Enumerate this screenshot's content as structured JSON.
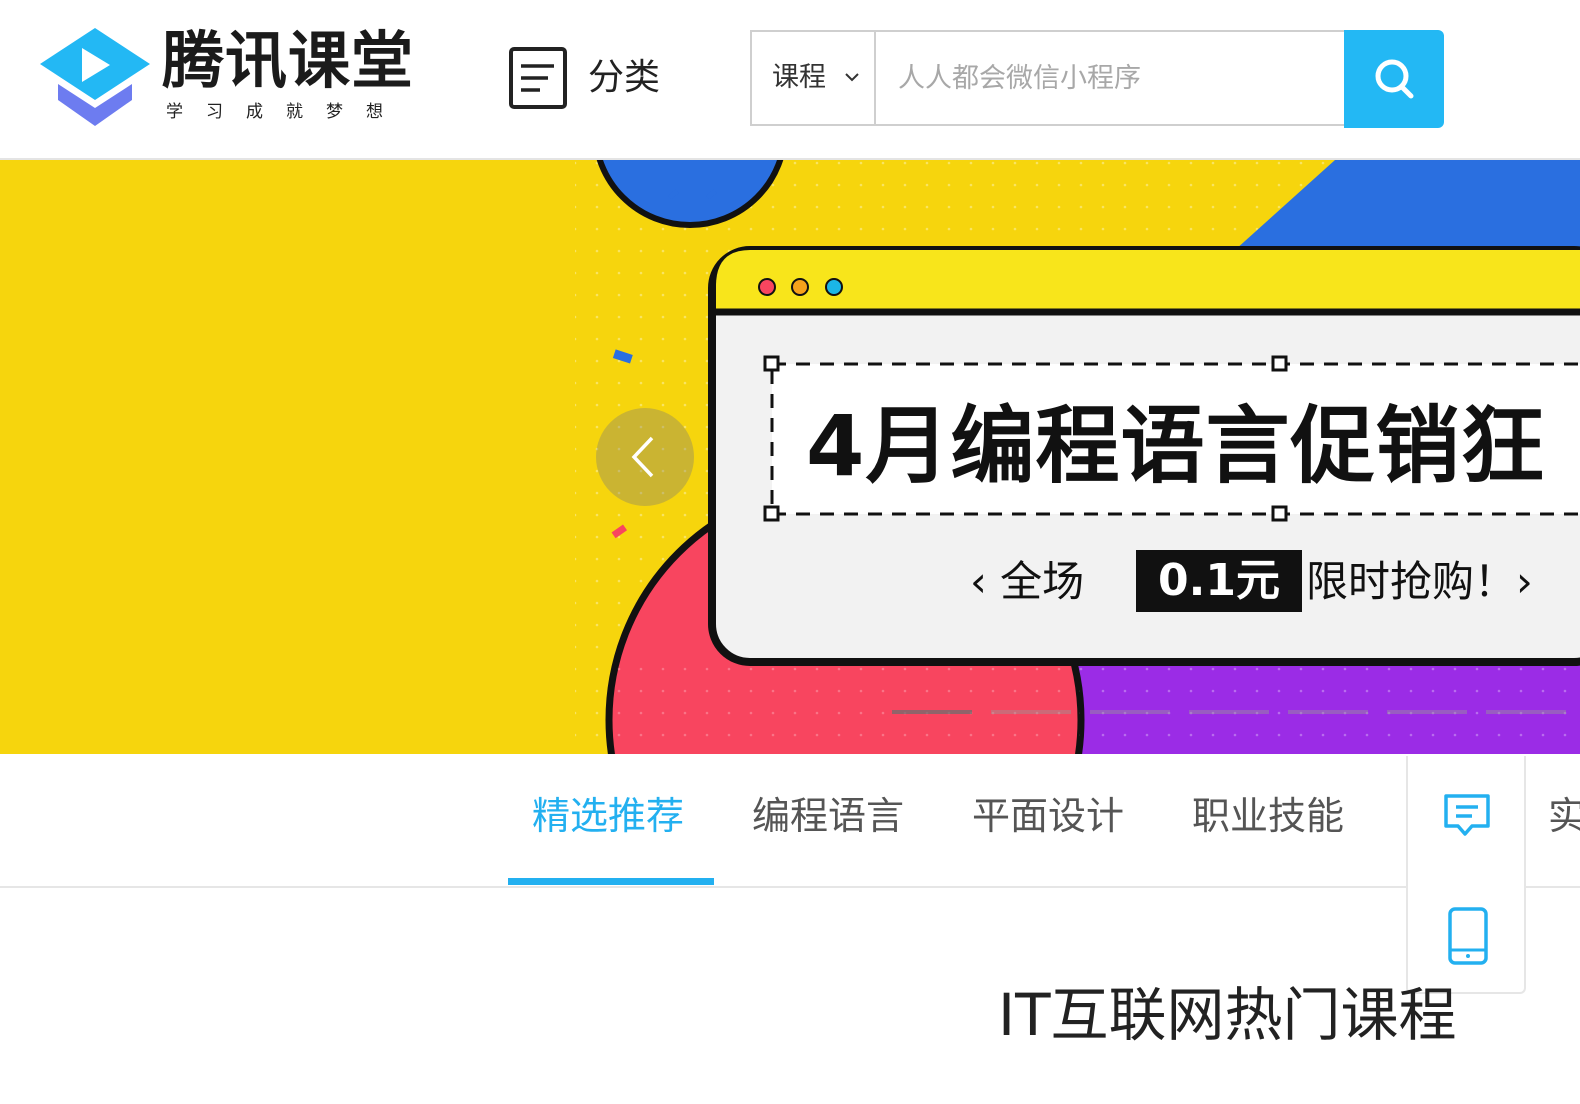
{
  "header": {
    "logo": {
      "name": "腾讯课堂",
      "tagline": "学习成就梦想",
      "icon": "play-graduation-cap-icon"
    },
    "category": {
      "label": "分类",
      "icon": "list-document-icon"
    },
    "search": {
      "scope_label": "课程",
      "scope_icon": "chevron-down-icon",
      "placeholder": "人人都会微信小程序",
      "button_icon": "search-icon",
      "button_color": "#23b8f4"
    }
  },
  "banner": {
    "title": "4月编程语言促销狂",
    "subtitle_prefix": "‹ 全场",
    "price": "0.1元",
    "subtitle_suffix": "限时抢购！›",
    "prev_icon": "chevron-left-icon",
    "slide_count": 7,
    "active_slide": 1,
    "colors": {
      "yellow": "#f6d50d",
      "blue": "#2a6fe0",
      "red": "#f8455f",
      "purple": "#9b2ce6"
    }
  },
  "tabs": [
    {
      "label": "精选推荐",
      "active": true
    },
    {
      "label": "编程语言",
      "active": false
    },
    {
      "label": "平面设计",
      "active": false
    },
    {
      "label": "职业技能",
      "active": false
    },
    {
      "label": "实",
      "active": false
    }
  ],
  "float_panel": {
    "items": [
      {
        "icon": "chat-message-icon"
      },
      {
        "icon": "tablet-device-icon"
      }
    ]
  },
  "section": {
    "title": "IT互联网热门课程"
  },
  "accent_color": "#23b0f0"
}
